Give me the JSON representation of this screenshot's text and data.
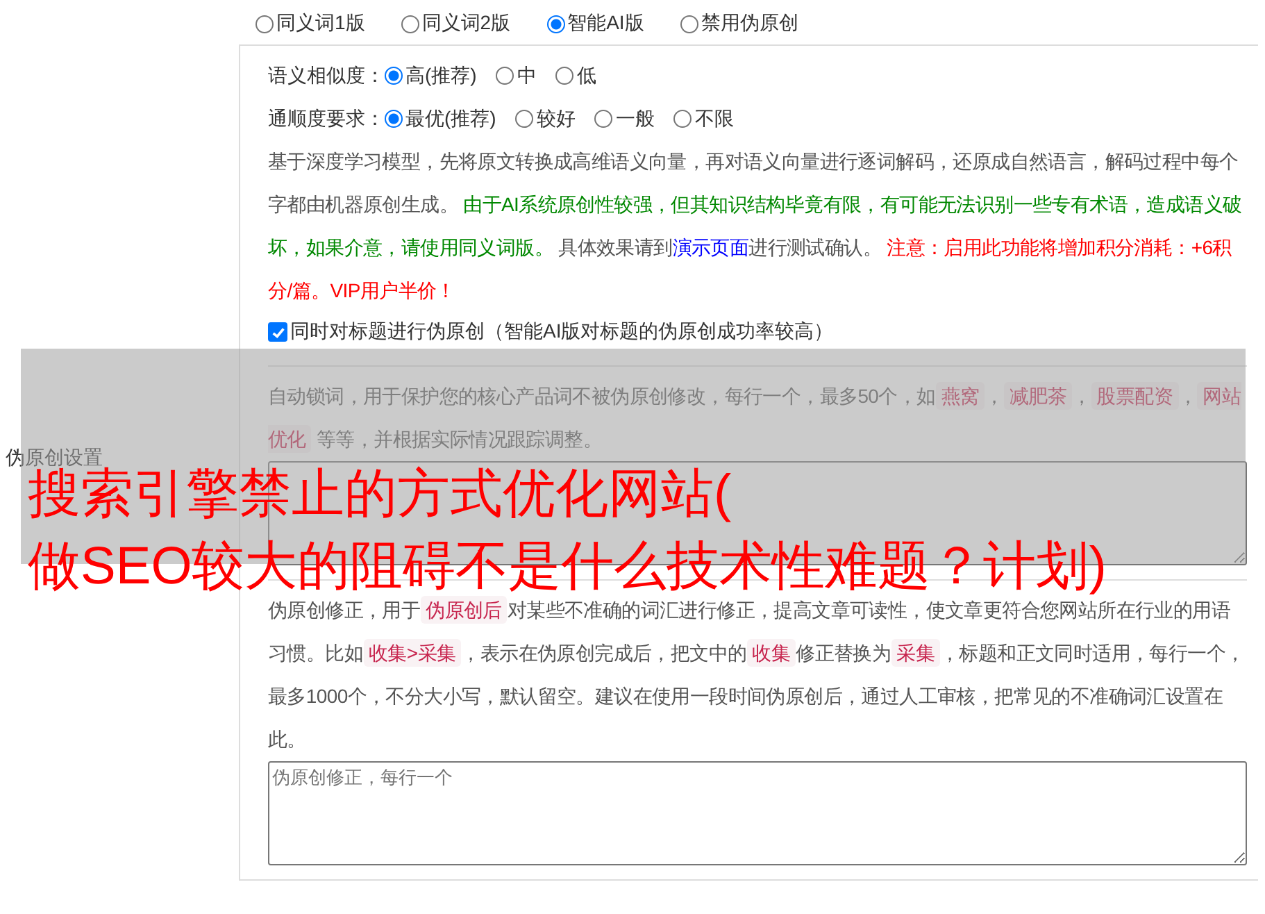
{
  "setting_label": "伪原创设置",
  "mode_options": [
    {
      "label": "同义词1版",
      "selected": false
    },
    {
      "label": "同义词2版",
      "selected": false
    },
    {
      "label": "智能AI版",
      "selected": true
    },
    {
      "label": "禁用伪原创",
      "selected": false
    }
  ],
  "option_rows": [
    {
      "label": "语义相似度：",
      "options": [
        {
          "label": "高(推荐)",
          "selected": true
        },
        {
          "label": "中",
          "selected": false
        },
        {
          "label": "低",
          "selected": false
        }
      ]
    },
    {
      "label": "通顺度要求：",
      "options": [
        {
          "label": "最优(推荐)",
          "selected": true
        },
        {
          "label": "较好",
          "selected": false
        },
        {
          "label": "一般",
          "selected": false
        },
        {
          "label": "不限",
          "selected": false
        }
      ]
    }
  ],
  "ai_description": [
    {
      "kind": "text",
      "text": "基于深度学习模型，先将原文转换成高维语义向量，再对语义向量进行逐词解码，还原成自然语言，解码过程中每个字都由机器原创生成。 "
    },
    {
      "kind": "green",
      "text": "由于AI系统原创性较强，但其知识结构毕竟有限，有可能无法识别一些专有术语，造成语义破坏，如果介意，请使用同义词版。"
    },
    {
      "kind": "text",
      "text": " 具体效果请到"
    },
    {
      "kind": "link",
      "text": "演示页面"
    },
    {
      "kind": "text",
      "text": "进行测试确认。 "
    },
    {
      "kind": "red",
      "text": "注意：启用此功能将增加积分消耗：+6积分/篇。VIP用户半价！"
    }
  ],
  "title_option": {
    "label": "同时对标题进行伪原创（智能AI版对标题的伪原创成功率较高）",
    "checked": true
  },
  "lock_words": {
    "description": [
      {
        "kind": "text",
        "text": "自动锁词，用于保护您的核心产品词不被伪原创修改，每行一个，最多50个，如"
      },
      {
        "kind": "tag",
        "text": "燕窝"
      },
      {
        "kind": "text",
        "text": "，"
      },
      {
        "kind": "tag",
        "text": "减肥茶"
      },
      {
        "kind": "text",
        "text": "，"
      },
      {
        "kind": "tag",
        "text": "股票配资"
      },
      {
        "kind": "text",
        "text": "，"
      },
      {
        "kind": "tag",
        "text": "网站优化"
      },
      {
        "kind": "text",
        "text": " 等等，并根据实际情况跟踪调整。"
      }
    ]
  },
  "correction": {
    "description": [
      {
        "kind": "text",
        "text": "伪原创修正，用于"
      },
      {
        "kind": "tag",
        "text": "伪原创后"
      },
      {
        "kind": "text",
        "text": "对某些不准确的词汇进行修正，提高文章可读性，使文章更符合您网站所在行业的用语习惯。比如"
      },
      {
        "kind": "tag",
        "text": "收集>采集"
      },
      {
        "kind": "text",
        "text": "，表示在伪原创完成后，把文中的"
      },
      {
        "kind": "tag",
        "text": "收集"
      },
      {
        "kind": "text",
        "text": "修正替换为"
      },
      {
        "kind": "tag",
        "text": "采集"
      },
      {
        "kind": "text",
        "text": "，标题和正文同时适用，每行一个，最多1000个，不分大小写，默认留空。建议在使用一段时间伪原创后，通过人工审核，把常见的不准确词汇设置在此。"
      }
    ],
    "placeholder": "伪原创修正，每行一个"
  },
  "overlay_title": [
    "搜索引擎禁止的方式优化网站(",
    "做SEO较大的阻碍不是什么技术性难题？计划)"
  ]
}
